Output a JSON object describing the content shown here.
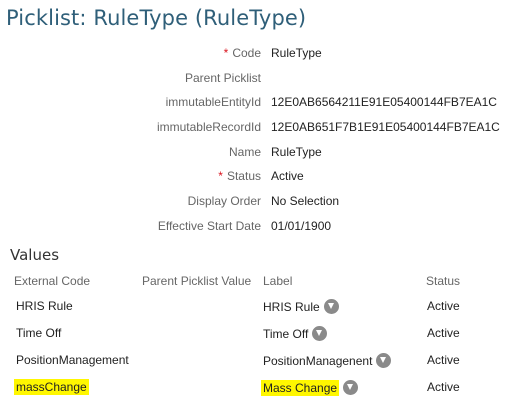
{
  "page": {
    "title": "Picklist: RuleType (RuleType)"
  },
  "fields": [
    {
      "label": "Code",
      "required": true,
      "value": "RuleType"
    },
    {
      "label": "Parent Picklist",
      "required": false,
      "value": ""
    },
    {
      "label": "immutableEntityId",
      "required": false,
      "value": "12E0AB6564211E91E05400144FB7EA1C"
    },
    {
      "label": "immutableRecordId",
      "required": false,
      "value": "12E0AB651F7B1E91E05400144FB7EA1C"
    },
    {
      "label": "Name",
      "required": false,
      "value": "RuleType"
    },
    {
      "label": "Status",
      "required": true,
      "value": "Active"
    },
    {
      "label": "Display Order",
      "required": false,
      "value": "No Selection"
    },
    {
      "label": "Effective Start Date",
      "required": false,
      "value": "01/01/1900"
    }
  ],
  "required_marker": "*",
  "values_section": {
    "title": "Values",
    "columns": {
      "external_code": "External Code",
      "parent_value": "Parent Picklist Value",
      "label": "Label",
      "status": "Status"
    },
    "rows": [
      {
        "external_code": "HRIS Rule",
        "parent_value": "",
        "label": "HRIS Rule",
        "status": "Active",
        "highlighted": false,
        "icon": "chevron-down-icon"
      },
      {
        "external_code": "Time Off",
        "parent_value": "",
        "label": "Time Off",
        "status": "Active",
        "highlighted": false,
        "icon": "chevron-down-icon"
      },
      {
        "external_code": "PositionManagement",
        "parent_value": "",
        "label": "PositionManagenent",
        "status": "Active",
        "highlighted": false,
        "icon": "chevron-down-icon"
      },
      {
        "external_code": "massChange",
        "parent_value": "",
        "label": "Mass Change",
        "status": "Active",
        "highlighted": true,
        "icon": "chevron-down-icon"
      }
    ]
  },
  "colors": {
    "title": "#2f5f79",
    "required": "#d9141e",
    "highlight": "#fff700"
  }
}
